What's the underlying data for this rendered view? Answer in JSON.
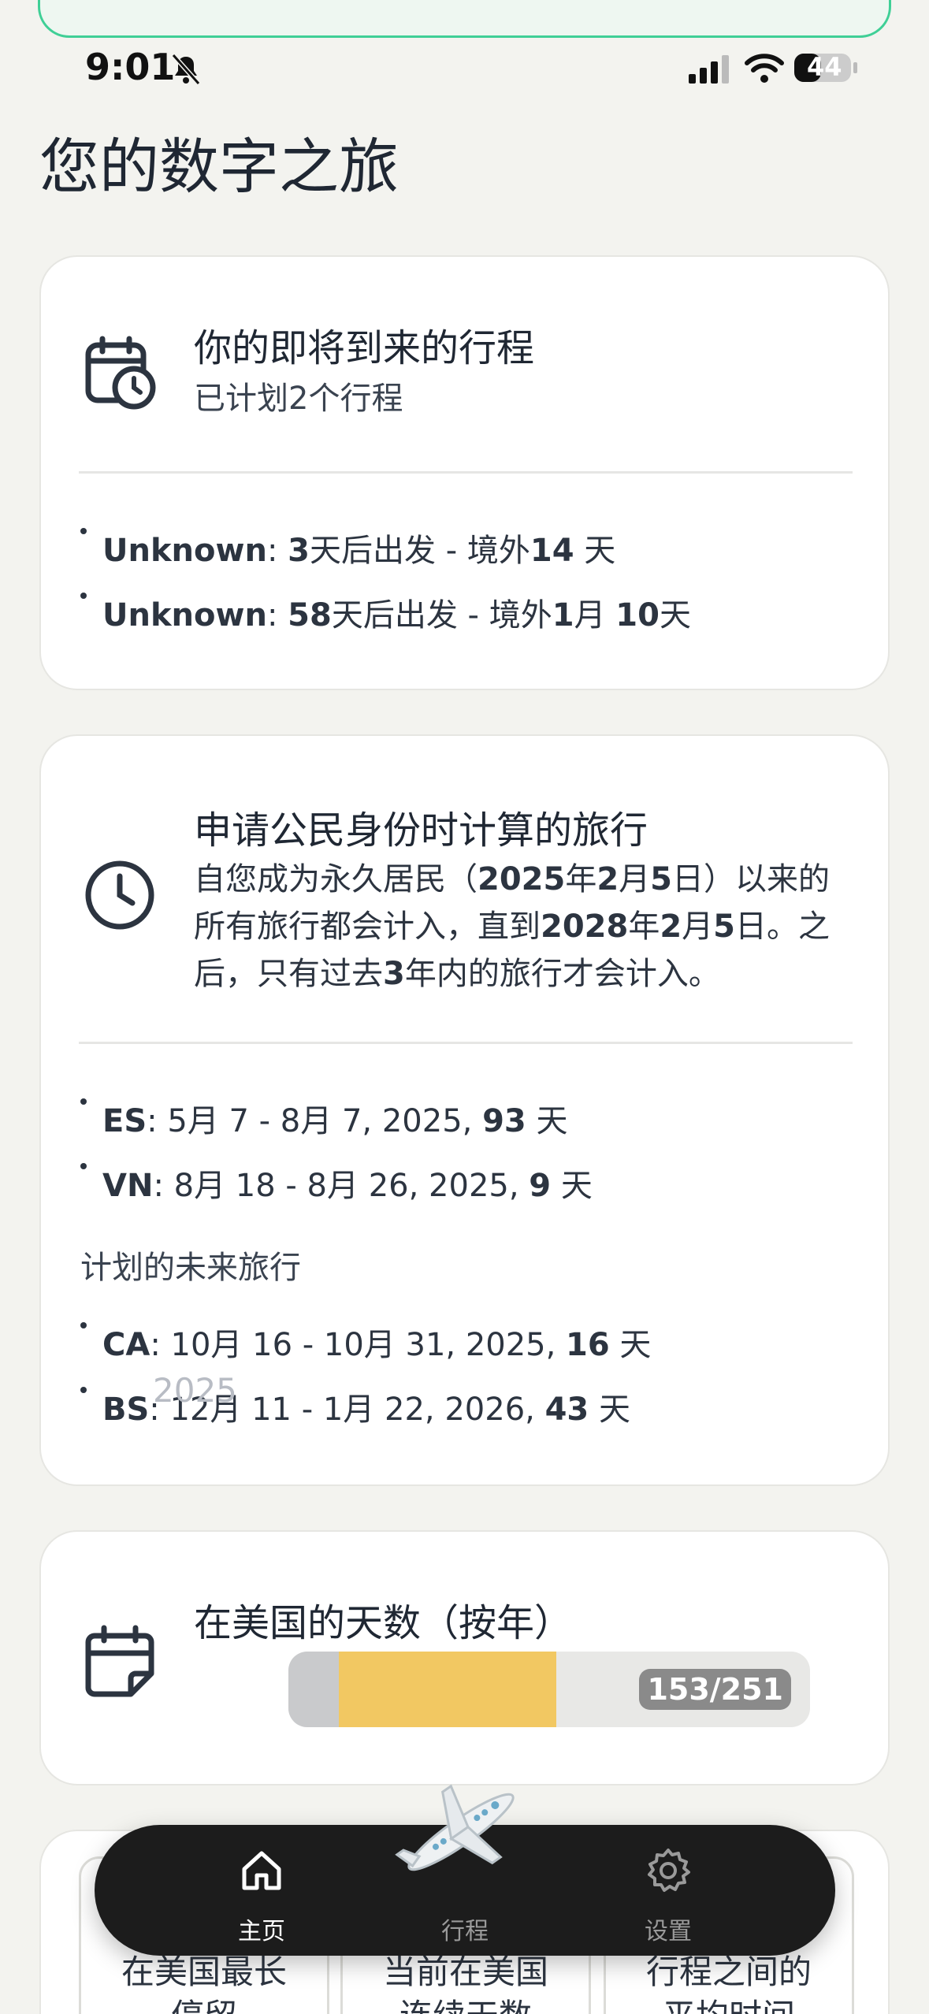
{
  "status": {
    "time": "9:01",
    "battery": "44"
  },
  "page": {
    "title": "您的数字之旅"
  },
  "upcoming": {
    "title": "你的即将到来的行程",
    "subtitle": "已计划2个行程",
    "items": [
      {
        "name": "Unknown",
        "sep": ": ",
        "days": "3",
        "mid": "天后出发 - 境外",
        "away": "14",
        "tail": " 天"
      },
      {
        "name": "Unknown",
        "sep": ": ",
        "days": "58",
        "mid": "天后出发 - 境外",
        "away": "1",
        "tail2": "月 ",
        "away2": "10",
        "tail": "天"
      }
    ]
  },
  "citizenship": {
    "title": "申请公民身份时计算的旅行",
    "desc_line1_a": "自您成为永久居民（",
    "desc_line1_b": "2025",
    "desc_line1_c": "年",
    "desc_line1_d": "2",
    "desc_line1_e": "月",
    "desc_line1_f": "5",
    "desc_line1_g": "日）以来的",
    "desc_line2_a": "所有旅行都会计入，直到",
    "desc_line2_b": "2028",
    "desc_line2_c": "年",
    "desc_line2_d": "2",
    "desc_line2_e": "月",
    "desc_line2_f": "5",
    "desc_line2_g": "日。之",
    "desc_line3_a": "后，只有过去",
    "desc_line3_b": "3",
    "desc_line3_c": "年内的旅行才会计入。",
    "past_trips": [
      {
        "code": "ES",
        "range": ": 5月 7 - 8月 7, 2025, ",
        "days": "93",
        "unit": " 天"
      },
      {
        "code": "VN",
        "range": ": 8月 18 - 8月 26, 2025, ",
        "days": "9",
        "unit": " 天"
      }
    ],
    "future_label": "计划的未来旅行",
    "future_trips": [
      {
        "code": "CA",
        "range": ": 10月 16 - 10月 31, 2025, ",
        "days": "16",
        "unit": " 天"
      },
      {
        "code": "BS",
        "range": ": 12月 11 - 1月 22, 2026, ",
        "days": "43",
        "unit": " 天"
      }
    ]
  },
  "days_in_us": {
    "title": "在美国的天数（按年）",
    "year": "2025",
    "badge": "153/251",
    "fraction": 0.61
  },
  "mini_cards": [
    {
      "label1": "在美国最长",
      "label2": "停留"
    },
    {
      "label1": "当前在美国",
      "label2": "连续天数"
    },
    {
      "label1": "行程之间的",
      "label2": "平均时间"
    }
  ],
  "tabs": [
    {
      "label": "主页",
      "icon": "home-icon",
      "active": true
    },
    {
      "label": "行程",
      "icon": "trips-icon",
      "active": false
    },
    {
      "label": "设置",
      "icon": "gear-icon",
      "active": false
    }
  ],
  "colors": {
    "accent_green": "#3fcf96",
    "bar_yellow": "#f2c862",
    "tab_bg": "#1c1c1c"
  }
}
